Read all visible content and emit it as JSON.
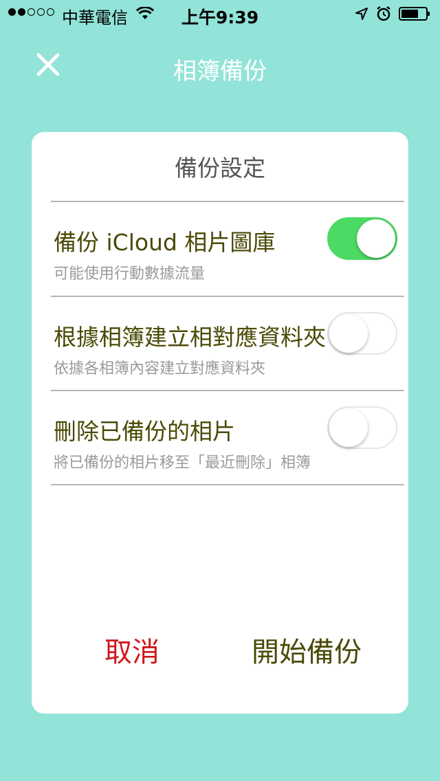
{
  "status_bar": {
    "carrier": "中華電信",
    "time": "上午9:39",
    "signal_bars": 2,
    "icons": [
      "wifi-icon",
      "location-arrow-icon",
      "alarm-icon",
      "battery-icon"
    ]
  },
  "nav": {
    "title": "相簿備份",
    "close_icon": "close-icon"
  },
  "dialog": {
    "title": "備份設定",
    "settings": [
      {
        "title": "備份 iCloud 相片圖庫",
        "subtitle": "可能使用行動數據流量",
        "enabled": true
      },
      {
        "title": "根據相簿建立相對應資料夾",
        "subtitle": "依據各相簿內容建立對應資料夾",
        "enabled": false
      },
      {
        "title": "刪除已備份的相片",
        "subtitle": "將已備份的相片移至「最近刪除」相簿",
        "enabled": false
      }
    ],
    "cancel_label": "取消",
    "start_label": "開始備份"
  },
  "colors": {
    "background": "#92e3d8",
    "toggle_on": "#4cd964",
    "cancel": "#d0171b",
    "accent_text": "#4b4a07"
  }
}
